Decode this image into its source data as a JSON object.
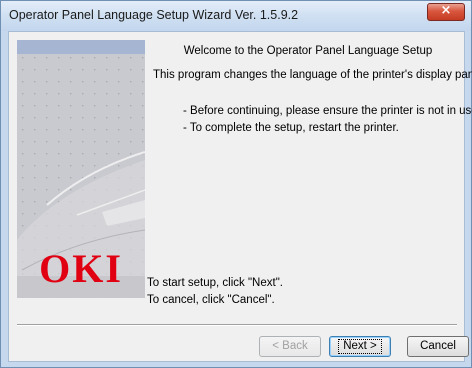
{
  "window": {
    "title": "Operator Panel Language Setup Wizard Ver. 1.5.9.2",
    "close_glyph": "×"
  },
  "banner": {
    "logo_text": "OKI",
    "logo_color": "#e00012"
  },
  "main": {
    "welcome": "Welcome to the Operator Panel Language Setup",
    "description": "This program changes the language of the printer's display panel.",
    "notes": [
      "- Before continuing, please ensure the printer is not in use.",
      "- To complete the setup, restart the printer."
    ],
    "start_instruction": "To start setup, click \"Next\".",
    "cancel_instruction": "To cancel, click \"Cancel\"."
  },
  "buttons": {
    "back": "< Back",
    "next": "Next >",
    "cancel": "Cancel"
  }
}
